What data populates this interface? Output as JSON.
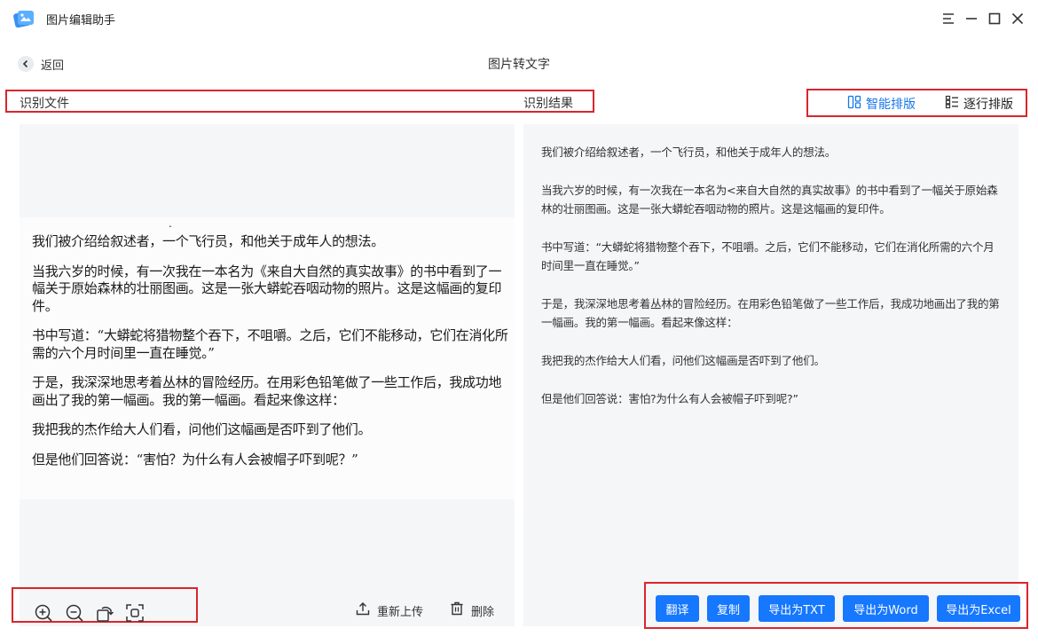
{
  "window": {
    "app_title": "图片编辑助手",
    "logo_icon": "app-logo-icon",
    "controls": [
      "menu-icon",
      "minimize-icon",
      "maximize-icon",
      "close-icon"
    ]
  },
  "nav": {
    "back_label": "返回",
    "page_title": "图片转文字"
  },
  "header": {
    "left_label": "识别文件",
    "right_label": "识别结果",
    "smart_layout_label": "智能排版",
    "line_layout_label": "逐行排版"
  },
  "image_text": {
    "paragraphs": [
      "我们被介绍给叙述者，一个飞行员，和他关于成年人的想法。",
      "当我六岁的时候，有一次我在一本名为《来自大自然的真实故事》的书中看到了一幅关于原始森林的壮丽图画。这是一张大蟒蛇吞咽动物的照片。这是这幅画的复印件。",
      "书中写道：“大蟒蛇将猎物整个吞下，不咀嚼。之后，它们不能移动，它们在消化所需的六个月时间里一直在睡觉。”",
      "于是，我深深地思考着丛林的冒险经历。在用彩色铅笔做了一些工作后，我成功地画出了我的第一幅画。我的第一幅画。看起来像这样：",
      "我把我的杰作给大人们看，问他们这幅画是否吓到了他们。",
      "但是他们回答说：“害怕？为什么有人会被帽子吓到呢？”"
    ]
  },
  "toolbar": {
    "reupload_label": "重新上传",
    "delete_label": "删除"
  },
  "result_text": {
    "paragraphs": [
      "我们被介绍给叙述者，一个飞行员，和他关于成年人的想法。",
      "当我六岁的时候，有一次我在一本名为<来自大自然的真实故事》的书中看到了一幅关于原始森林的壮丽图画。这是一张大蟒蛇吞咽动物的照片。这是这幅画的复印件。",
      "书中写道：“大蟒蛇将猎物整个吞下，不咀嚼。之后，它们不能移动，它们在消化所需的六个月时间里一直在睡觉。”",
      "于是，我深深地思考着丛林的冒险经历。在用彩色铅笔做了一些工作后，我成功地画出了我的第一幅画。我的第一幅画。看起来像这样：",
      "我把我的杰作给大人们看，问他们这幅画是否吓到了他们。",
      "但是他们回答说：害怕?为什么有人会被帽子吓到呢?”"
    ]
  },
  "actions": {
    "translate": "翻译",
    "copy": "复制",
    "export_txt": "导出为TXT",
    "export_word": "导出为Word",
    "export_excel": "导出为Excel"
  },
  "colors": {
    "accent": "#1677ff",
    "highlight_border": "#d9262c",
    "panel_bg": "#f5f6f8"
  }
}
